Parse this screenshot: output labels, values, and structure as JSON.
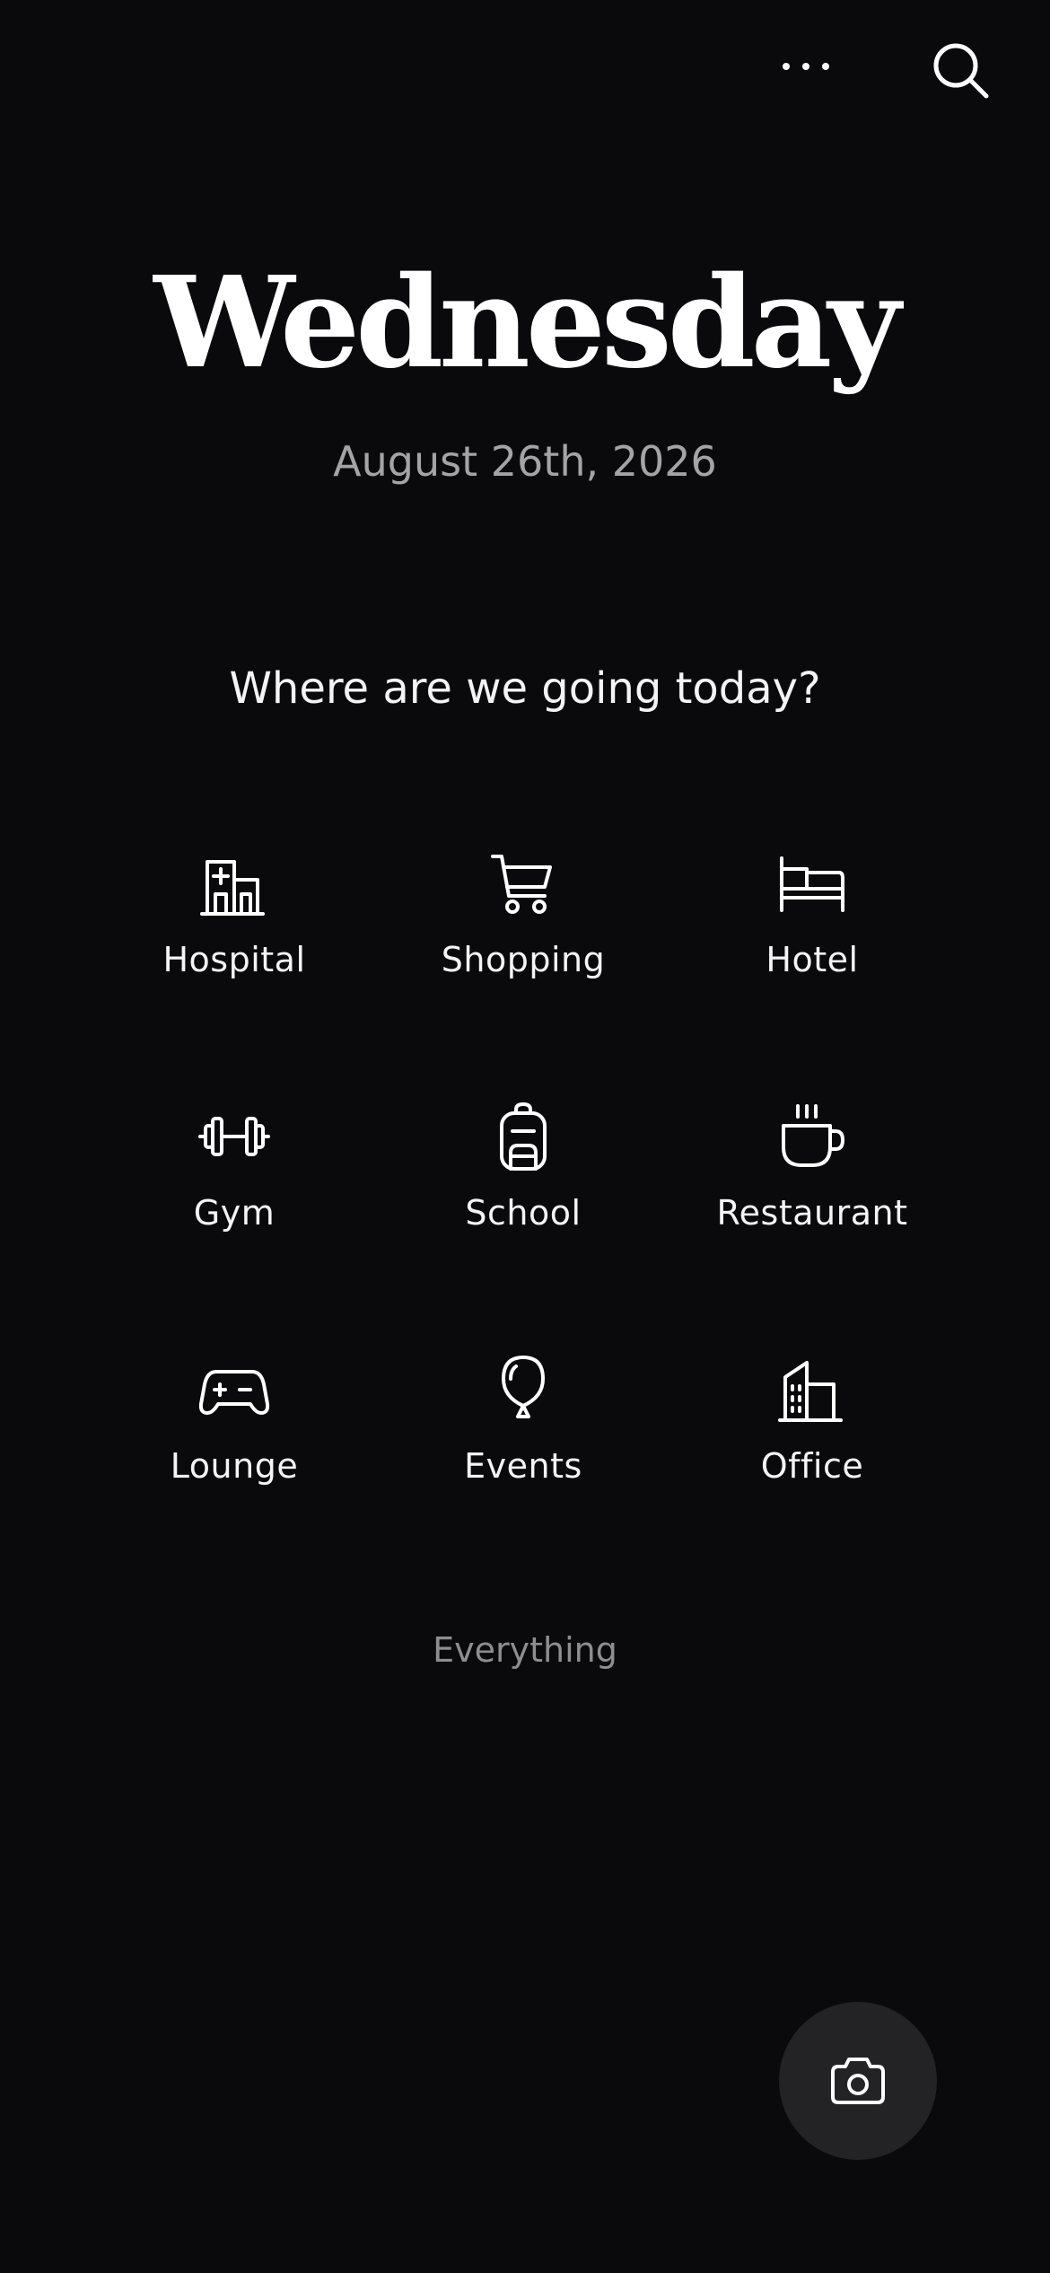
{
  "header": {
    "more_icon": "more-horizontal-icon",
    "search_icon": "search-icon"
  },
  "hero": {
    "day": "Wednesday",
    "date": "August 26th, 2026"
  },
  "prompt": "Where are we going today?",
  "destinations": [
    {
      "label": "Hospital",
      "icon": "hospital-icon"
    },
    {
      "label": "Shopping",
      "icon": "shopping-cart-icon"
    },
    {
      "label": "Hotel",
      "icon": "bed-icon"
    },
    {
      "label": "Gym",
      "icon": "dumbbell-icon"
    },
    {
      "label": "School",
      "icon": "backpack-icon"
    },
    {
      "label": "Restaurant",
      "icon": "coffee-cup-icon"
    },
    {
      "label": "Lounge",
      "icon": "game-controller-icon"
    },
    {
      "label": "Events",
      "icon": "balloon-icon"
    },
    {
      "label": "Office",
      "icon": "office-building-icon"
    }
  ],
  "everything_label": "Everything",
  "fab": {
    "icon": "camera-icon"
  },
  "colors": {
    "background": "#0a0a0c",
    "text": "#ffffff",
    "subtle_text": "#a3a3a8",
    "muted_text": "#8d8d92",
    "fab_background": "#232325"
  }
}
